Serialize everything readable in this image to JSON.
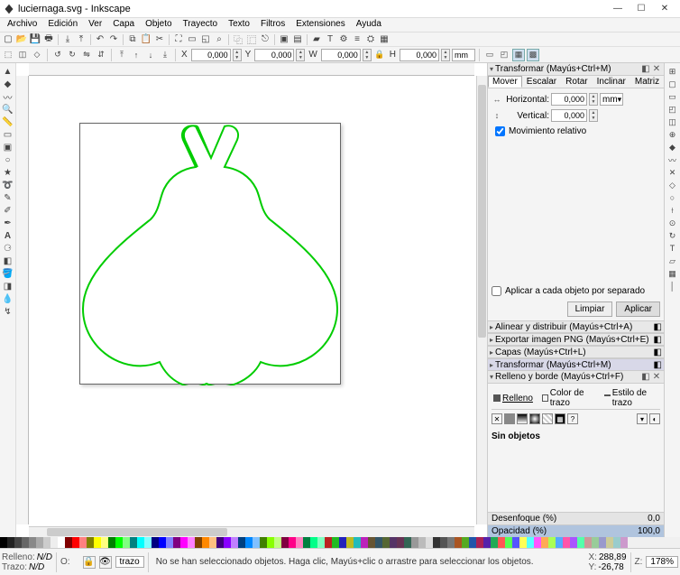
{
  "window": {
    "title": "luciernaga.svg - Inkscape",
    "min": "—",
    "max": "☐",
    "close": "✕"
  },
  "menu": [
    "Archivo",
    "Edición",
    "Ver",
    "Capa",
    "Objeto",
    "Trayecto",
    "Texto",
    "Filtros",
    "Extensiones",
    "Ayuda"
  ],
  "tb2": {
    "x_lbl": "X",
    "x_val": "0,000",
    "y_lbl": "Y",
    "y_val": "0,000",
    "w_lbl": "W",
    "w_val": "0,000",
    "h_lbl": "H",
    "h_val": "0,000",
    "unit": "mm"
  },
  "panels": {
    "transform_title": "Transformar (Mayús+Ctrl+M)",
    "tabs": {
      "mover": "Mover",
      "escalar": "Escalar",
      "rotar": "Rotar",
      "inclinar": "Inclinar",
      "matriz": "Matriz"
    },
    "horizontal_lbl": "Horizontal:",
    "horizontal_val": "0,000",
    "vertical_lbl": "Vertical:",
    "vertical_val": "0,000",
    "unit": "mm",
    "relative": "Movimiento relativo",
    "apply_each": "Aplicar a cada objeto por separado",
    "clear": "Limpiar",
    "apply": "Aplicar",
    "align": "Alinear y distribuir (Mayús+Ctrl+A)",
    "export": "Exportar imagen PNG (Mayús+Ctrl+E)",
    "layers": "Capas (Mayús+Ctrl+L)",
    "transform_coll": "Transformar (Mayús+Ctrl+M)",
    "fill_title": "Relleno y borde (Mayús+Ctrl+F)",
    "fill_tab": "Relleno",
    "stroke_tab": "Color de trazo",
    "stroke_style_tab": "Estilo de trazo",
    "noobj": "Sin objetos",
    "blur_lbl": "Desenfoque (%)",
    "blur_val": "0,0",
    "opacity_lbl": "Opacidad (%)",
    "opacity_val": "100,0"
  },
  "status": {
    "fill_lbl": "Relleno:",
    "stroke_lbl": "Trazo:",
    "fill_val": "N/D",
    "stroke_val": "N/D",
    "o_lbl": "O:",
    "layer_val": "trazo",
    "hint": "No se han seleccionado objetos. Haga clic, Mayús+clic o arrastre para seleccionar los objetos.",
    "x_lbl": "X:",
    "x_val": "288,89",
    "y_lbl": "Y:",
    "y_val": "-26,78",
    "z_lbl": "Z:",
    "zoom": "178%"
  },
  "chart_data": null
}
